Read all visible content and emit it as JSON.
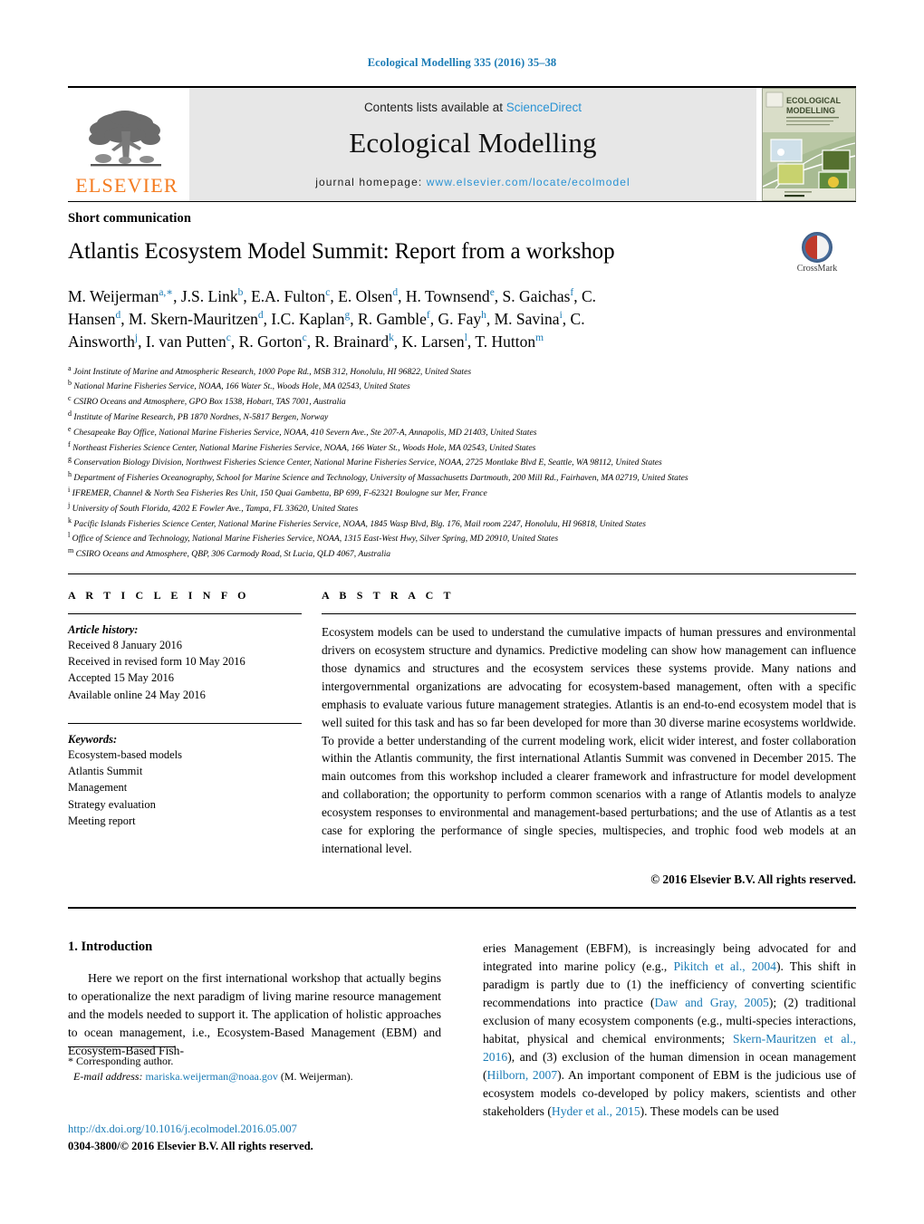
{
  "running_head": "Ecological Modelling 335 (2016) 35–38",
  "masthead": {
    "publisher_name": "ELSEVIER",
    "contents_prefix": "Contents lists available at ",
    "contents_link": "ScienceDirect",
    "journal_name": "Ecological Modelling",
    "homepage_prefix": "journal homepage: ",
    "homepage_url": "www.elsevier.com/locate/ecolmodel",
    "cover_title_line1": "ECOLOGICAL",
    "cover_title_line2": "MODELLING"
  },
  "article": {
    "doctype": "Short communication",
    "title": "Atlantis Ecosystem Model Summit: Report from a workshop",
    "crossmark_label": "CrossMark",
    "authors_line1": "M. Weijerman",
    "authors_html": "M. Weijerman<sup>a,∗</sup>, J.S. Link<sup>b</sup>, E.A. Fulton<sup>c</sup>, E. Olsen<sup>d</sup>, H. Townsend<sup>e</sup>, S. Gaichas<sup>f</sup>, C. Hansen<sup>d</sup>, M. Skern-Mauritzen<sup>d</sup>, I.C. Kaplan<sup>g</sup>, R. Gamble<sup>f</sup>, G. Fay<sup>h</sup>, M. Savina<sup>i</sup>, C. Ainsworth<sup>j</sup>, I. van Putten<sup>c</sup>, R. Gorton<sup>c</sup>, R. Brainard<sup>k</sup>, K. Larsen<sup>l</sup>, T. Hutton<sup>m</sup>"
  },
  "affiliations": [
    {
      "mark": "a",
      "text": "Joint Institute of Marine and Atmospheric Research, 1000 Pope Rd., MSB 312, Honolulu, HI 96822, United States"
    },
    {
      "mark": "b",
      "text": "National Marine Fisheries Service, NOAA, 166 Water St., Woods Hole, MA 02543, United States"
    },
    {
      "mark": "c",
      "text": "CSIRO Oceans and Atmosphere, GPO Box 1538, Hobart, TAS 7001, Australia"
    },
    {
      "mark": "d",
      "text": "Institute of Marine Research, PB 1870 Nordnes, N-5817 Bergen, Norway"
    },
    {
      "mark": "e",
      "text": "Chesapeake Bay Office, National Marine Fisheries Service, NOAA, 410 Severn Ave., Ste 207-A, Annapolis, MD 21403, United States"
    },
    {
      "mark": "f",
      "text": "Northeast Fisheries Science Center, National Marine Fisheries Service, NOAA, 166 Water St., Woods Hole, MA 02543, United States"
    },
    {
      "mark": "g",
      "text": "Conservation Biology Division, Northwest Fisheries Science Center, National Marine Fisheries Service, NOAA, 2725 Montlake Blvd E, Seattle, WA 98112, United States"
    },
    {
      "mark": "h",
      "text": "Department of Fisheries Oceanography, School for Marine Science and Technology, University of Massachusetts Dartmouth, 200 Mill Rd., Fairhaven, MA 02719, United States"
    },
    {
      "mark": "i",
      "text": "IFREMER, Channel & North Sea Fisheries Res Unit, 150 Quai Gambetta, BP 699, F-62321 Boulogne sur Mer, France"
    },
    {
      "mark": "j",
      "text": "University of South Florida, 4202 E Fowler Ave., Tampa, FL 33620, United States"
    },
    {
      "mark": "k",
      "text": "Pacific Islands Fisheries Science Center, National Marine Fisheries Service, NOAA, 1845 Wasp Blvd, Blg. 176, Mail room 2247, Honolulu, HI 96818, United States"
    },
    {
      "mark": "l",
      "text": "Office of Science and Technology, National Marine Fisheries Service, NOAA, 1315 East-West Hwy, Silver Spring, MD 20910, United States"
    },
    {
      "mark": "m",
      "text": "CSIRO Oceans and Atmosphere, QBP, 306 Carmody Road, St Lucia, QLD 4067, Australia"
    }
  ],
  "article_info": {
    "heading": "A R T I C L E   I N F O",
    "history_label": "Article history:",
    "history": [
      "Received 8 January 2016",
      "Received in revised form 10 May 2016",
      "Accepted 15 May 2016",
      "Available online 24 May 2016"
    ],
    "keywords_label": "Keywords:",
    "keywords": [
      "Ecosystem-based models",
      "Atlantis Summit",
      "Management",
      "Strategy evaluation",
      "Meeting report"
    ]
  },
  "abstract": {
    "heading": "A B S T R A C T",
    "text": "Ecosystem models can be used to understand the cumulative impacts of human pressures and environmental drivers on ecosystem structure and dynamics. Predictive modeling can show how management can influence those dynamics and structures and the ecosystem services these systems provide. Many nations and intergovernmental organizations are advocating for ecosystem-based management, often with a specific emphasis to evaluate various future management strategies. Atlantis is an end-to-end ecosystem model that is well suited for this task and has so far been developed for more than 30 diverse marine ecosystems worldwide. To provide a better understanding of the current modeling work, elicit wider interest, and foster collaboration within the Atlantis community, the first international Atlantis Summit was convened in December 2015. The main outcomes from this workshop included a clearer framework and infrastructure for model development and collaboration; the opportunity to perform common scenarios with a range of Atlantis models to analyze ecosystem responses to environmental and management-based perturbations; and the use of Atlantis as a test case for exploring the performance of single species, multispecies, and trophic food web models at an international level.",
    "copyright": "© 2016 Elsevier B.V. All rights reserved."
  },
  "body": {
    "section_heading": "1. Introduction",
    "left_paragraph": "Here we report on the first international workshop that actually begins to operationalize the next paradigm of living marine resource management and the models needed to support it. The application of holistic approaches to ocean management, i.e., Ecosystem-Based Management (EBM) and Ecosystem-Based Fish-",
    "right_paragraph_html": "eries Management (EBFM), is increasingly being advocated for and integrated into marine policy (e.g., <span class=\"ref\">Pikitch et al., 2004</span>). This shift in paradigm is partly due to (1) the inefficiency of converting scientific recommendations into practice (<span class=\"ref\">Daw and Gray, 2005</span>); (2) traditional exclusion of many ecosystem components (e.g., multi-species interactions, habitat, physical and chemical environments; <span class=\"ref\">Skern-Mauritzen et al., 2016</span>), and (3) exclusion of the human dimension in ocean management (<span class=\"ref\">Hilborn, 2007</span>). An important component of EBM is the judicious use of ecosystem models co-developed by policy makers, scientists and other stakeholders (<span class=\"ref\">Hyder et al., 2015</span>). These models can be used"
  },
  "footnotes": {
    "corresponding_marker": "*",
    "corresponding_text": "Corresponding author.",
    "email_label": "E-mail address:",
    "email": "mariska.weijerman@noaa.gov",
    "email_suffix": "(M. Weijerman)."
  },
  "footer": {
    "doi": "http://dx.doi.org/10.1016/j.ecolmodel.2016.05.007",
    "issn_line": "0304-3800/© 2016 Elsevier B.V. All rights reserved."
  },
  "colors": {
    "link_blue": "#1a7bb5",
    "sciencedirect_blue": "#2a93d4",
    "elsevier_orange": "#F47B20",
    "band_gray": "#e7e7e7"
  }
}
